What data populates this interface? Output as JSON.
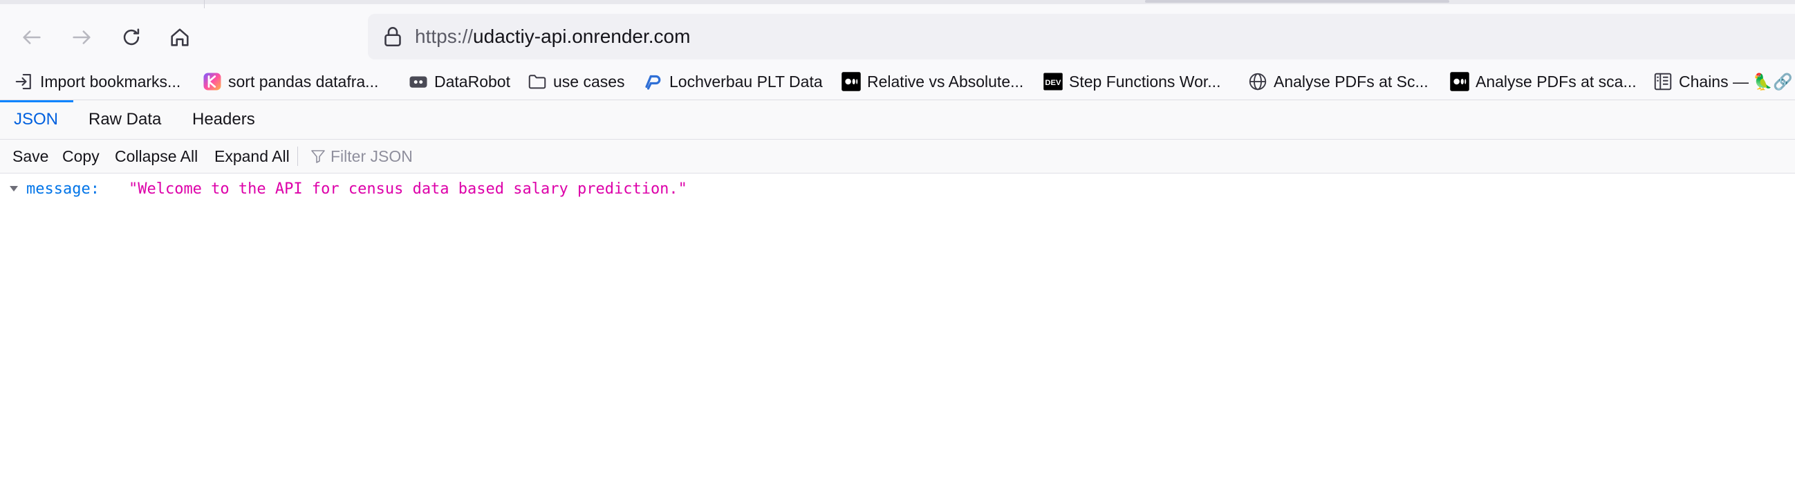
{
  "nav": {
    "back_icon": "arrow-left-icon",
    "forward_icon": "arrow-right-icon",
    "reload_icon": "reload-icon",
    "home_icon": "home-icon"
  },
  "urlbar": {
    "scheme": "https://",
    "host": "udactiy-api.onrender.com",
    "lock_icon": "lock-icon"
  },
  "bookmarks": [
    {
      "label": "Import bookmarks...",
      "icon": "import-icon"
    },
    {
      "label": "sort pandas datafra...",
      "icon": "app-logo-icon"
    },
    {
      "label": "DataRobot",
      "icon": "datarobot-icon"
    },
    {
      "label": "use cases",
      "icon": "folder-icon"
    },
    {
      "label": "Lochverbau PLT Data",
      "icon": "link-logo-icon"
    },
    {
      "label": "Relative vs Absolute...",
      "icon": "medium-icon"
    },
    {
      "label": "Step Functions Wor...",
      "icon": "dev-icon"
    },
    {
      "label": "Analyse PDFs at Sc...",
      "icon": "globe-icon"
    },
    {
      "label": "Analyse PDFs at sca...",
      "icon": "medium-icon"
    },
    {
      "label": "Chains — 🦜🔗 L",
      "icon": "book-icon"
    }
  ],
  "viewer_tabs": [
    {
      "label": "JSON",
      "active": true
    },
    {
      "label": "Raw Data",
      "active": false
    },
    {
      "label": "Headers",
      "active": false
    }
  ],
  "toolbar": {
    "save": "Save",
    "copy": "Copy",
    "collapse_all": "Collapse All",
    "expand_all": "Expand All",
    "filter_placeholder": "Filter JSON"
  },
  "json": {
    "key": "message:",
    "value": "\"Welcome to the API for census data based salary prediction.\""
  },
  "colors": {
    "accent": "#0060df",
    "json_key": "#0074e8",
    "json_string": "#dd00a9"
  }
}
